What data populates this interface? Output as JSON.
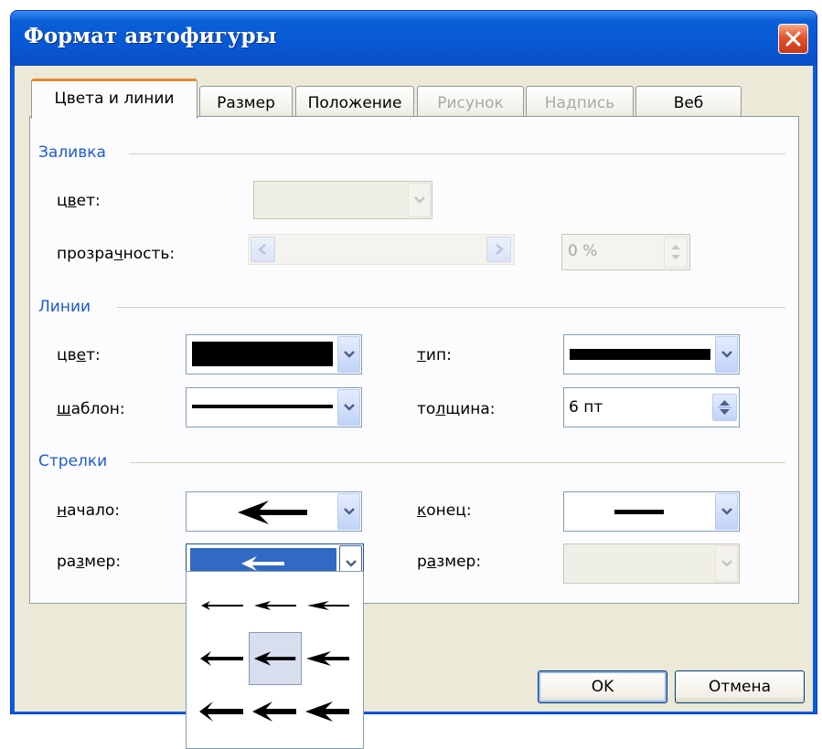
{
  "window": {
    "title": "Формат автофигуры"
  },
  "tabs": [
    {
      "label": "Цвета и линии",
      "active": true,
      "disabled": false
    },
    {
      "label": "Размер",
      "active": false,
      "disabled": false
    },
    {
      "label": "Положение",
      "active": false,
      "disabled": false
    },
    {
      "label": "Рисунок",
      "active": false,
      "disabled": true
    },
    {
      "label": "Надпись",
      "active": false,
      "disabled": true
    },
    {
      "label": "Веб",
      "active": false,
      "disabled": false
    }
  ],
  "fill": {
    "group_label": "Заливка",
    "color_label_a": "ц",
    "color_label_b": "в",
    "color_label_c": "ет:",
    "transparency_label_a": "прозра",
    "transparency_label_b": "ч",
    "transparency_label_c": "ность:",
    "transparency_value": "0 %"
  },
  "lines": {
    "group_label": "Линии",
    "color_label_a": "цв",
    "color_label_b": "е",
    "color_label_c": "т:",
    "pattern_label_a": "ш",
    "pattern_label_b": "аблон:",
    "type_label_a": "т",
    "type_label_b": "ип:",
    "weight_label_a": "то",
    "weight_label_b": "л",
    "weight_label_c": "щина:",
    "weight_value": "6 пт",
    "line_color": "#000000"
  },
  "arrows": {
    "group_label": "Стрелки",
    "begin_label_a": "н",
    "begin_label_b": "ачало:",
    "end_label_a": "к",
    "end_label_b": "онец:",
    "begin_size_label_a": "ра",
    "begin_size_label_b": "з",
    "begin_size_label_c": "мер:",
    "end_size_label_a": "р",
    "end_size_label_b": "а",
    "end_size_label_c": "змер:",
    "size_options_selected": "middle-middle"
  },
  "buttons": {
    "ok": "OK",
    "cancel": "Отмена"
  },
  "colors": {
    "title_bar": "#0a5fd6",
    "group_text": "#1d5ad6",
    "active_tab_accent": "#e68b2c",
    "selection": "#316ac5"
  }
}
